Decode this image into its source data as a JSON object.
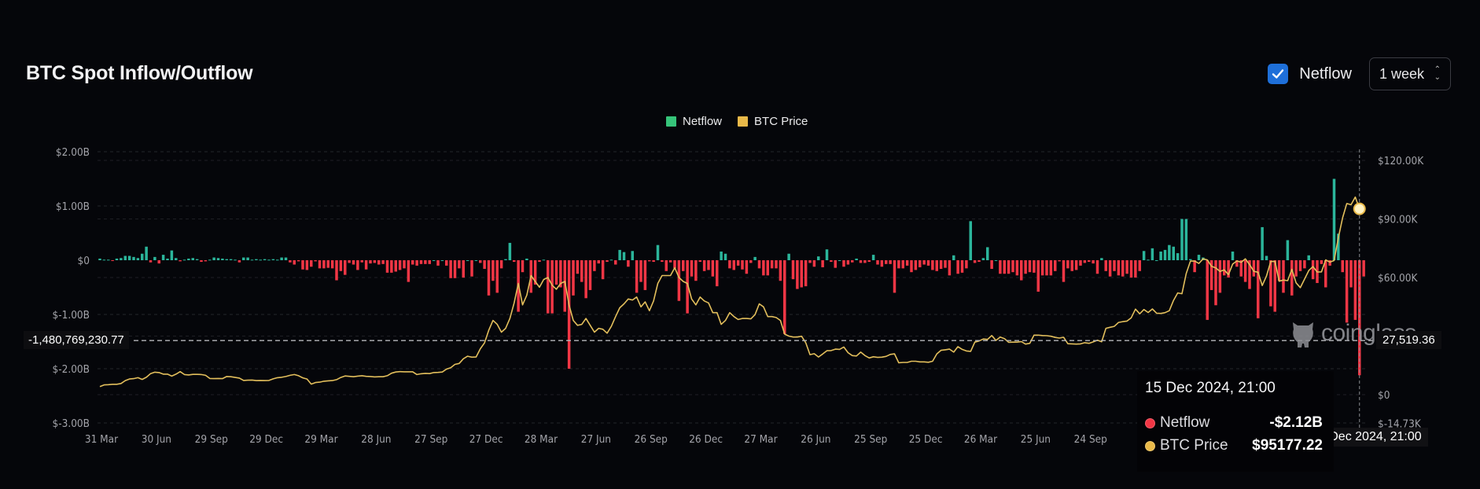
{
  "header": {
    "title": "BTC Spot Inflow/Outflow",
    "netflow_checkbox_label": "Netflow",
    "netflow_checked": true,
    "interval_select": "1 week",
    "checkbox_color": "#1e6fd9"
  },
  "watermark": "coinglass",
  "crosshair": {
    "left_value": "-1,480,769,230.77",
    "right_value": "27,519.36",
    "x_label": "15 Dec 2024, 21:00"
  },
  "tooltip": {
    "date": "15 Dec 2024, 21:00",
    "rows": [
      {
        "label": "Netflow",
        "value": "-$2.12B",
        "color": "#f23645"
      },
      {
        "label": "BTC Price",
        "value": "$95177.22",
        "color": "#e9b949"
      }
    ]
  },
  "chart_data": {
    "type": "bar+line",
    "legend": [
      {
        "name": "Netflow",
        "color": "#36c47a"
      },
      {
        "name": "BTC Price",
        "color": "#e9b949"
      }
    ],
    "legend_position": "top-center",
    "grid": true,
    "x_ticks": [
      "31 Mar",
      "30 Jun",
      "29 Sep",
      "29 Dec",
      "29 Mar",
      "28 Jun",
      "27 Sep",
      "27 Dec",
      "28 Mar",
      "27 Jun",
      "26 Sep",
      "26 Dec",
      "27 Mar",
      "26 Jun",
      "25 Sep",
      "25 Dec",
      "26 Mar",
      "25 Jun",
      "24 Sep"
    ],
    "y_left": {
      "ticks": [
        "$2.00B",
        "$1.00B",
        "$0",
        "$-1.00B",
        "$-2.00B",
        "$-3.00B"
      ],
      "range_billion_usd": [
        -3,
        2
      ]
    },
    "y_right": {
      "ticks": [
        "$120.00K",
        "$90.00K",
        "$60.00K",
        "$0",
        "$-14.73K"
      ],
      "range_thousand_usd": [
        -14.73,
        120
      ]
    },
    "colors": {
      "positive": "#2bb59b",
      "negative": "#f23645",
      "price": "#e3bf5c"
    },
    "series": [
      {
        "name": "Netflow",
        "unit": "billion USD",
        "values": [
          0.03,
          0.01,
          0.01,
          -0.01,
          0.03,
          0.04,
          0.08,
          0.08,
          0.06,
          0.04,
          0.12,
          0.25,
          -0.04,
          0.06,
          -0.06,
          0.1,
          0.03,
          0.18,
          0.04,
          -0.02,
          0.01,
          0.03,
          0.04,
          0.02,
          -0.03,
          -0.02,
          0.01,
          0.05,
          0.04,
          0.03,
          0.02,
          0.02,
          0.01,
          -0.04,
          0.05,
          0.05,
          0.01,
          0.02,
          0.01,
          0.02,
          0.01,
          0.02,
          0.01,
          0.05,
          0.05,
          -0.04,
          -0.08,
          -0.02,
          -0.17,
          -0.18,
          -0.12,
          -0.02,
          -0.15,
          -0.15,
          -0.14,
          -0.15,
          -0.37,
          -0.2,
          -0.27,
          -0.05,
          -0.08,
          -0.18,
          -0.04,
          -0.17,
          -0.06,
          -0.05,
          -0.08,
          -0.07,
          -0.23,
          -0.23,
          -0.21,
          -0.18,
          -0.15,
          -0.4,
          -0.08,
          -0.1,
          -0.07,
          -0.07,
          -0.07,
          0,
          -0.1,
          0,
          -0.1,
          -0.33,
          -0.33,
          -0.15,
          -0.32,
          0,
          -0.3,
          0,
          -0.05,
          -0.16,
          -0.65,
          -0.38,
          -0.6,
          -0.15,
          0.02,
          0.32,
          -0.03,
          -0.95,
          -0.22,
          0.03,
          -0.6,
          -0.45,
          -0.03,
          0.01,
          -0.98,
          -0.98,
          -0.45,
          -0.5,
          -0.95,
          -2.0,
          -0.65,
          -0.25,
          -0.4,
          -0.7,
          -0.55,
          -0.2,
          -0.06,
          -0.35,
          -0.03,
          0.01,
          -0.08,
          0.19,
          0.15,
          -0.12,
          0.17,
          -0.6,
          -0.4,
          -0.55,
          -0.02,
          -0.03,
          0.28,
          -0.03,
          -0.2,
          -0.04,
          -0.15,
          -0.75,
          -0.2,
          -0.98,
          -0.3,
          -0.38,
          -0.03,
          -0.2,
          -0.18,
          -0.3,
          -0.48,
          0.16,
          0.12,
          -0.15,
          -0.18,
          -0.1,
          -0.17,
          -0.25,
          -0.05,
          0.06,
          -0.15,
          -0.28,
          -0.28,
          -0.15,
          -0.15,
          -0.38,
          -1.36,
          0.12,
          -0.35,
          -0.53,
          -0.5,
          -0.48,
          -0.05,
          -0.12,
          0.07,
          -0.13,
          0.2,
          -0.03,
          -0.14,
          0,
          -0.12,
          -0.08,
          -0.04,
          0.03,
          -0.05,
          -0.05,
          -0.03,
          0.1,
          -0.08,
          -0.12,
          -0.07,
          -0.07,
          -0.6,
          -0.15,
          -0.15,
          -0.1,
          -0.22,
          -0.18,
          -0.13,
          -0.08,
          -0.1,
          -0.18,
          -0.2,
          -0.16,
          -0.14,
          -0.28,
          0.09,
          -0.25,
          -0.23,
          -0.15,
          0.72,
          -0.05,
          -0.03,
          0.04,
          0.24,
          -0.16,
          0,
          -0.25,
          -0.25,
          -0.25,
          -0.22,
          -0.28,
          -0.37,
          -0.25,
          -0.22,
          -0.23,
          -0.58,
          -0.28,
          -0.28,
          -0.28,
          -0.2,
          -0.02,
          -0.4,
          -0.15,
          -0.2,
          -0.18,
          -0.1,
          -0.05,
          -0.03,
          -0.06,
          -0.25,
          0.04,
          -0.2,
          -0.3,
          -0.2,
          -0.28,
          -0.3,
          -0.25,
          -0.32,
          -0.32,
          -0.2,
          0.17,
          0.01,
          0.22,
          0,
          0.16,
          0.19,
          0.28,
          0.25,
          0.13,
          0.76,
          0.76,
          0.02,
          -0.22,
          0.1,
          0.05,
          -1.1,
          -0.55,
          -0.83,
          -0.6,
          -0.28,
          -0.32,
          0.16,
          -0.12,
          -0.3,
          -0.4,
          -0.53,
          -0.3,
          -1.07,
          0.61,
          0.08,
          -0.85,
          -0.95,
          -0.38,
          -0.6,
          0.37,
          -0.65,
          -0.3,
          -0.2,
          -0.15,
          0.09,
          -0.35,
          -0.42,
          -0.07,
          -0.5,
          -0.1,
          1.5,
          0.49,
          -0.22,
          -1.15,
          -0.5,
          -1.1,
          -2.12,
          -0.3
        ]
      },
      {
        "name": "BTC Price",
        "unit": "thousand USD",
        "values": [
          4.1,
          5.0,
          5.1,
          5.3,
          5.3,
          5.7,
          7.2,
          8.0,
          8.2,
          8.7,
          7.8,
          8.9,
          10.8,
          11.5,
          11.3,
          10.5,
          10.5,
          9.5,
          10.5,
          11.8,
          10.3,
          10.1,
          10.4,
          10.4,
          10.3,
          9.9,
          8.3,
          8.2,
          8.3,
          8.2,
          9.3,
          9.2,
          8.8,
          8.5,
          7.3,
          7.4,
          7.5,
          7.2,
          7.3,
          7.2,
          7.3,
          8.1,
          8.7,
          8.9,
          9.3,
          9.9,
          10.3,
          9.7,
          8.6,
          8.0,
          5.4,
          6.2,
          6.4,
          6.9,
          7.1,
          7.2,
          7.7,
          8.8,
          9.6,
          9.4,
          9.2,
          9.5,
          9.7,
          9.4,
          9.3,
          9.1,
          9.2,
          9.2,
          9.7,
          11.0,
          11.6,
          11.8,
          11.7,
          11.7,
          11.7,
          10.3,
          10.7,
          10.9,
          10.8,
          11.3,
          11.4,
          11.6,
          13.1,
          13.8,
          15.5,
          16.0,
          18.4,
          19.7,
          19.2,
          19.3,
          23.5,
          26.5,
          33,
          38,
          36,
          32,
          34,
          39,
          47,
          57,
          46,
          51,
          61,
          58,
          55,
          59,
          60,
          56,
          54,
          57,
          58,
          46,
          38,
          35.5,
          36,
          39,
          35.5,
          32,
          34,
          33.5,
          31.5,
          35,
          40,
          44.5,
          46.5,
          49,
          48.5,
          50,
          45,
          47.5,
          43,
          48,
          57,
          61,
          61,
          61,
          65,
          60,
          58,
          57,
          49,
          46,
          50,
          48,
          47,
          42,
          42,
          36,
          38,
          42,
          40,
          38.5,
          39,
          39,
          38.8,
          41,
          46.5,
          45,
          40,
          40,
          39.5,
          38,
          31,
          30,
          29.5,
          29.5,
          29.9,
          26.6,
          20.5,
          21.0,
          19.3,
          20.8,
          22.5,
          22.6,
          23.3,
          23.2,
          24.4,
          21.5,
          20.0,
          19.8,
          21.8,
          20.0,
          18.8,
          19.4,
          19.1,
          19.2,
          19.6,
          20.6,
          20.9,
          16.3,
          16.5,
          16.5,
          17.1,
          17.1,
          16.8,
          16.8,
          16.6,
          17.1,
          20.9,
          22.7,
          23.0,
          23.3,
          21.8,
          24.6,
          23.2,
          22.4,
          22.2,
          26.9,
          27.5,
          28.5,
          28.3,
          30.3,
          27.8,
          29.5,
          28.7,
          26.8,
          26.9,
          26.9,
          27.2,
          25.9,
          26.3,
          30.5,
          30.5,
          30.3,
          30.2,
          29.9,
          29.3,
          29.0,
          29.4,
          26.1,
          26.0,
          25.9,
          26.0,
          26.6,
          26.3,
          27.0,
          27.9,
          27.1,
          34.0,
          34.5,
          35.0,
          37.0,
          37.4,
          37.7,
          39.4,
          43.8,
          41.4,
          43.6,
          42.1,
          43.9,
          41.7,
          41.6,
          42.0,
          43.0,
          48.3,
          52.1,
          51.7,
          62.0,
          68.4,
          68.4,
          67.2,
          69.6,
          69.0,
          65.7,
          64.9,
          63.1,
          63.9,
          61.5,
          66.9,
          68.5,
          67.8,
          69.6,
          66.6,
          63.2,
          62.7,
          55.9,
          60.8,
          68.2,
          68.3,
          58.1,
          58.7,
          58.4,
          64.2,
          57.3,
          54.8,
          59.2,
          63.6,
          65.6,
          62.8,
          62.9,
          69.0,
          67.9,
          68.7,
          80.4,
          90.6,
          97.9,
          97.3,
          101.2,
          95.18,
          null
        ]
      }
    ]
  }
}
